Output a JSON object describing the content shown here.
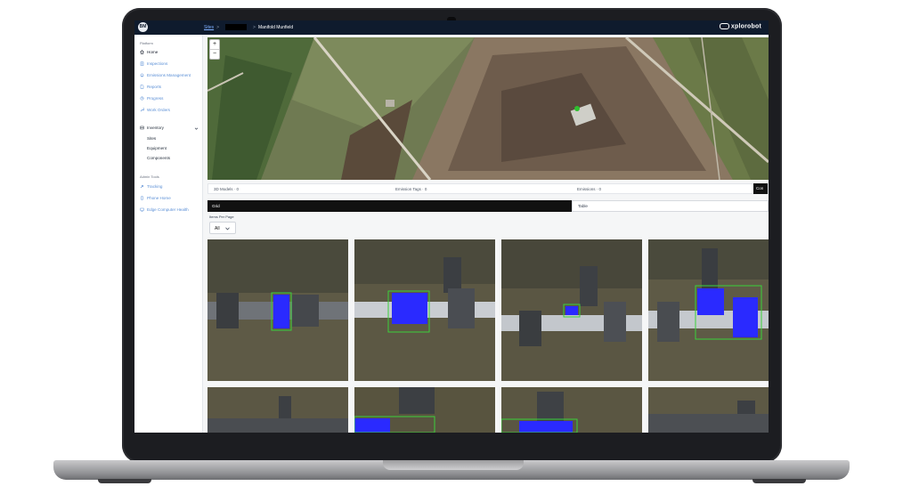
{
  "topbar": {
    "avatar_initials": "BM",
    "breadcrumb_sites": "Sites",
    "breadcrumb_separator": ">",
    "breadcrumb_current": "Manifold Munfield",
    "brand": "xplorobot"
  },
  "sidebar": {
    "platform_label": "Platform",
    "items": [
      {
        "label": "Home",
        "icon": "home-icon"
      },
      {
        "label": "Inspections",
        "icon": "clipboard-icon"
      },
      {
        "label": "Emissions Management",
        "icon": "gas-icon"
      },
      {
        "label": "Reports",
        "icon": "document-icon"
      },
      {
        "label": "Progress",
        "icon": "progress-icon"
      },
      {
        "label": "Work Orders",
        "icon": "wrench-icon"
      }
    ],
    "inventory": {
      "label": "Inventory",
      "children": [
        "Sites",
        "Equipment",
        "Components"
      ]
    },
    "admin_label": "Admin Tools",
    "admin_items": [
      {
        "label": "Tracking",
        "icon": "satellite-icon"
      },
      {
        "label": "Phone Home",
        "icon": "phone-icon"
      },
      {
        "label": "Edge Computer Health",
        "icon": "computer-icon"
      }
    ]
  },
  "map": {
    "zoom_in": "+",
    "zoom_out": "−"
  },
  "stats": {
    "models": "3D Models · 0",
    "emission_tags": "Emission Tags · 0",
    "emissions": "Emissions · 0",
    "overflow": "Con"
  },
  "view": {
    "grid": "Grid",
    "table": "Table"
  },
  "pagination": {
    "items_per_page_label": "Items Per Page",
    "items_per_page_value": "All"
  },
  "colors": {
    "topbar": "#0f1b2d",
    "link": "#5b8fd6",
    "detection_mask": "#2a2aff",
    "detection_box": "#3bd13b"
  }
}
